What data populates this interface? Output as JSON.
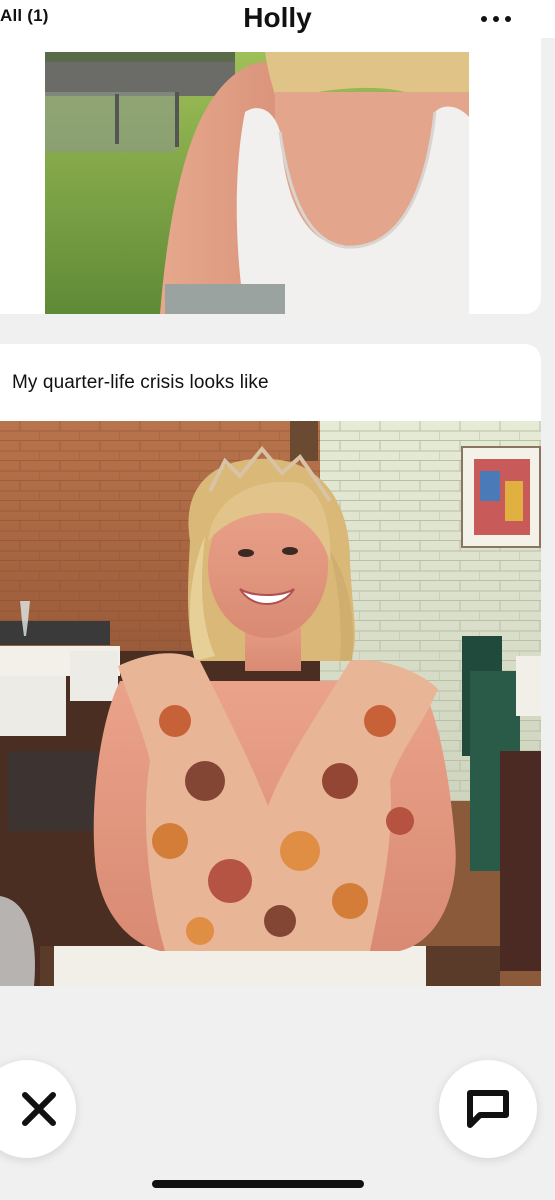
{
  "header": {
    "back_label": "All (1)",
    "title": "Holly",
    "more_icon": "more-horizontal-icon"
  },
  "cards": [
    {
      "type": "photo",
      "image": "photo-woman-white-tank-top-garden"
    },
    {
      "type": "prompt-photo",
      "prompt": "My quarter-life crisis looks like",
      "image": "photo-woman-paisley-dress-restaurant"
    }
  ],
  "actions": {
    "skip_icon": "close-x-icon",
    "reply_icon": "speech-bubble-icon"
  },
  "colors": {
    "background": "#f0f0f0",
    "card": "#ffffff",
    "text": "#111111"
  }
}
